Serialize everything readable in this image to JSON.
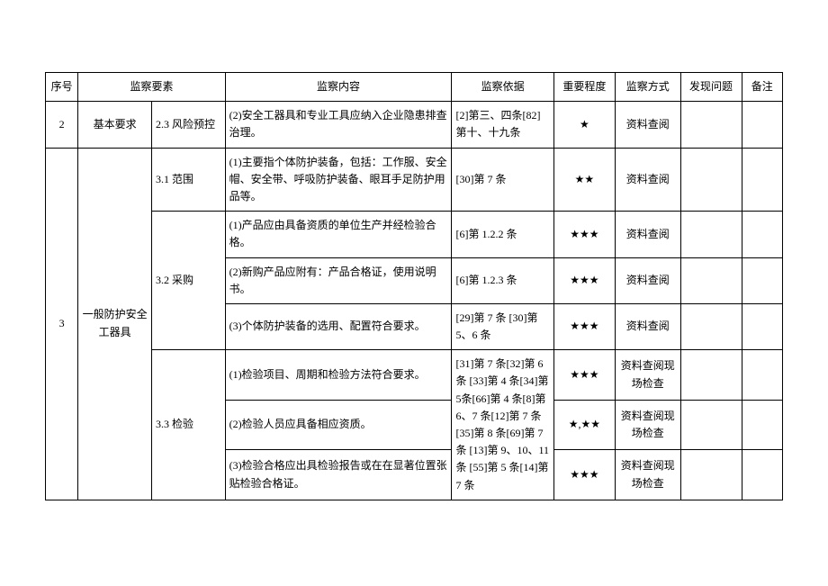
{
  "headers": {
    "seq": "序号",
    "element": "监察要素",
    "content": "监察内容",
    "basis": "监察依据",
    "importance": "重要程度",
    "method": "监察方式",
    "problem": "发现问题",
    "remark": "备注"
  },
  "rows": [
    {
      "seq": "2",
      "elementA": "基本要求",
      "elementB": "2.3 风险预控",
      "content": "(2)安全工器具和专业工具应纳入企业隐患排查治理。",
      "basis": "[2]第三、四条[82]第十、十九条",
      "importance": "★",
      "method": "资料查阅",
      "problem": "",
      "remark": ""
    },
    {
      "seq": "3",
      "elementA": "一般防护安全工器具",
      "elementB": "3.1 范围",
      "content": "(1)主要指个体防护装备，包括：工作服、安全帽、安全带、呼吸防护装备、眼耳手足防护用品等。",
      "basis": "[30]第 7 条",
      "importance": "★★",
      "method": "资料查阅",
      "problem": "",
      "remark": ""
    },
    {
      "elementB": "3.2 采购",
      "content": "(1)产品应由具备资质的单位生产并经检验合格。",
      "basis": "[6]第 1.2.2 条",
      "importance": "★★★",
      "method": "资料查阅",
      "problem": "",
      "remark": ""
    },
    {
      "content": "(2)新购产品应附有：产品合格证，使用说明书。",
      "basis": "[6]第 1.2.3 条",
      "importance": "★★★",
      "method": "资料查阅",
      "problem": "",
      "remark": ""
    },
    {
      "content": "(3)个体防护装备的选用、配置符合要求。",
      "basis": "[29]第 7 条\n[30]第 5、6 条",
      "importance": "★★★",
      "method": "资料查阅",
      "problem": "",
      "remark": ""
    },
    {
      "elementB": "3.3 检验",
      "content": "(1)检验项目、周期和检验方法符合要求。",
      "basisMerged": "[31]第 7 条[32]第 6条\n[33]第 4 条[34]第 5条[66]第 4 条[8]第6、7 条[12]第 7 条[35]第 8 条[69]第 7条\n[13]第 9、10、11条\n[55]第 5 条[14]第7 条",
      "importance": "★★★",
      "method": "资料查阅现场检查",
      "problem": "",
      "remark": ""
    },
    {
      "content": "(2)检验人员应具备相应资质。",
      "importance": "★,★★",
      "method": "资料查阅现场检查",
      "problem": "",
      "remark": ""
    },
    {
      "content": "(3)检验合格应出具检验报告或在在显著位置张贴检验合格证。",
      "importance": "★★★",
      "method": "资料查阅现场检查",
      "problem": "",
      "remark": ""
    }
  ]
}
